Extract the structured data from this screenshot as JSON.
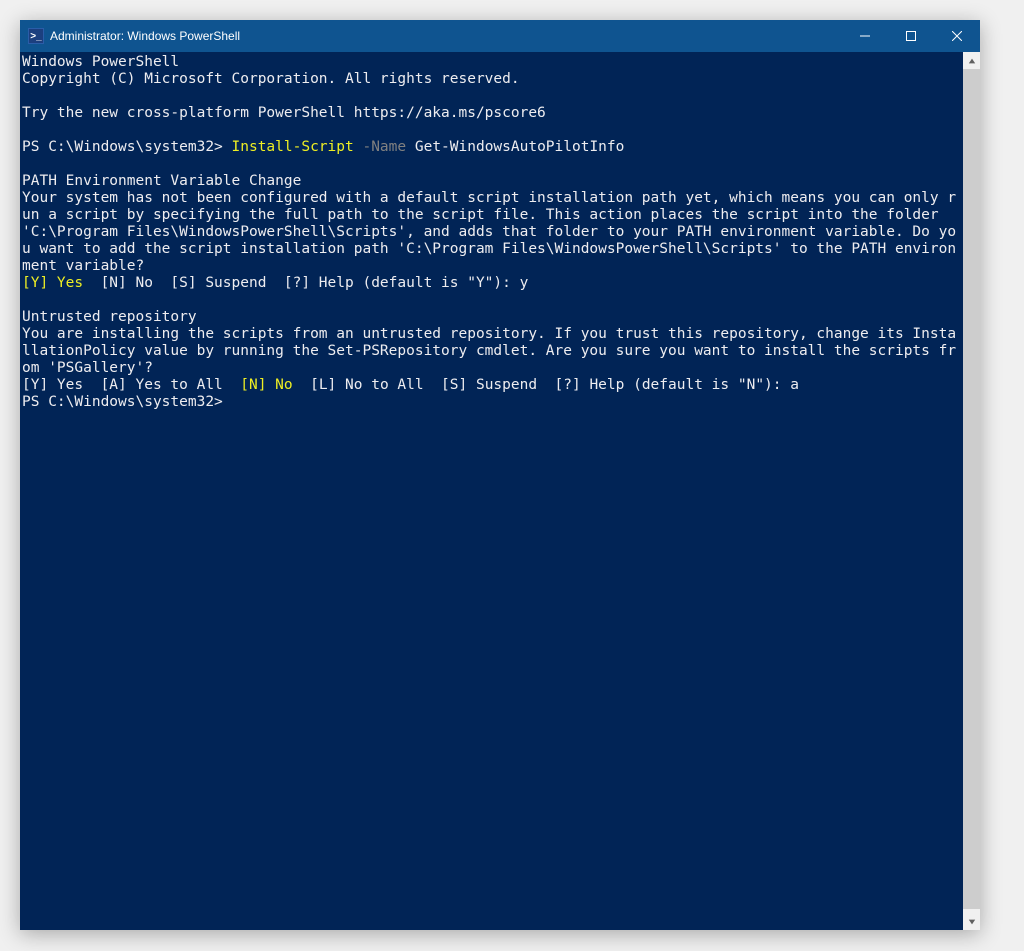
{
  "titlebar": {
    "icon_glyph": ">_",
    "title": "Administrator: Windows PowerShell"
  },
  "console": {
    "banner1": "Windows PowerShell",
    "banner2": "Copyright (C) Microsoft Corporation. All rights reserved.",
    "banner3": "Try the new cross-platform PowerShell https://aka.ms/pscore6",
    "prompt1_prefix": "PS C:\\Windows\\system32> ",
    "cmd_verb": "Install-Script",
    "cmd_param_flag": " -Name",
    "cmd_arg": " Get-WindowsAutoPilotInfo",
    "path_header": "PATH Environment Variable Change",
    "path_body": "Your system has not been configured with a default script installation path yet, which means you can only run a script by specifying the full path to the script file. This action places the script into the folder 'C:\\Program Files\\WindowsPowerShell\\Scripts', and adds that folder to your PATH environment variable. Do you want to add the script installation path 'C:\\Program Files\\WindowsPowerShell\\Scripts' to the PATH environment variable?",
    "path_choice_yes": "[Y] Yes",
    "path_choice_rest": "  [N] No  [S] Suspend  [?] Help (default is \"Y\"): y",
    "untrust_header": "Untrusted repository",
    "untrust_body": "You are installing the scripts from an untrusted repository. If you trust this repository, change its InstallationPolicy value by running the Set-PSRepository cmdlet. Are you sure you want to install the scripts from 'PSGallery'?",
    "untrust_choice_pre": "[Y] Yes  [A] Yes to All  ",
    "untrust_choice_no": "[N] No",
    "untrust_choice_post": "  [L] No to All  [S] Suspend  [?] Help (default is \"N\"): a",
    "prompt2": "PS C:\\Windows\\system32>"
  }
}
